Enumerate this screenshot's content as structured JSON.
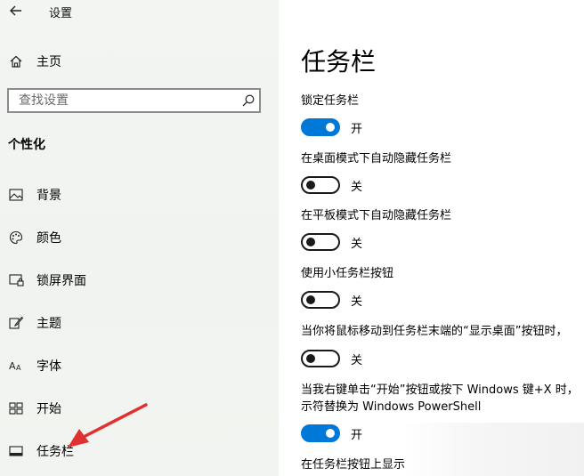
{
  "window": {
    "title": "设置"
  },
  "sidebar": {
    "home_label": "主页",
    "search_placeholder": "查找设置",
    "section_title": "个性化",
    "items": [
      {
        "id": "background",
        "label": "背景",
        "icon": "picture-icon"
      },
      {
        "id": "colors",
        "label": "颜色",
        "icon": "palette-icon"
      },
      {
        "id": "lockscreen",
        "label": "锁屏界面",
        "icon": "lockscreen-icon"
      },
      {
        "id": "themes",
        "label": "主题",
        "icon": "brush-icon"
      },
      {
        "id": "fonts",
        "label": "字体",
        "icon": "font-icon"
      },
      {
        "id": "start",
        "label": "开始",
        "icon": "start-icon"
      },
      {
        "id": "taskbar",
        "label": "任务栏",
        "icon": "taskbar-icon",
        "selected": true
      }
    ]
  },
  "main": {
    "title": "任务栏",
    "settings": [
      {
        "label": "锁定任务栏",
        "state": "on",
        "state_label": "开"
      },
      {
        "label": "在桌面模式下自动隐藏任务栏",
        "state": "off",
        "state_label": "关"
      },
      {
        "label": "在平板模式下自动隐藏任务栏",
        "state": "off",
        "state_label": "关"
      },
      {
        "label": "使用小任务栏按钮",
        "state": "off",
        "state_label": "关"
      },
      {
        "label": "当你将鼠标移动到任务栏末端的“显示桌面”按钮时，",
        "state": "off",
        "state_label": "关"
      },
      {
        "label": "当我右键单击“开始”按钮或按下 Windows 键+X 时，",
        "label_line2": "示符替换为 Windows PowerShell",
        "state": "on",
        "state_label": "开"
      }
    ],
    "partial_label": "在任务栏按钮上显示"
  },
  "colors": {
    "accent": "#0078d7",
    "arrow": "#e03030"
  }
}
